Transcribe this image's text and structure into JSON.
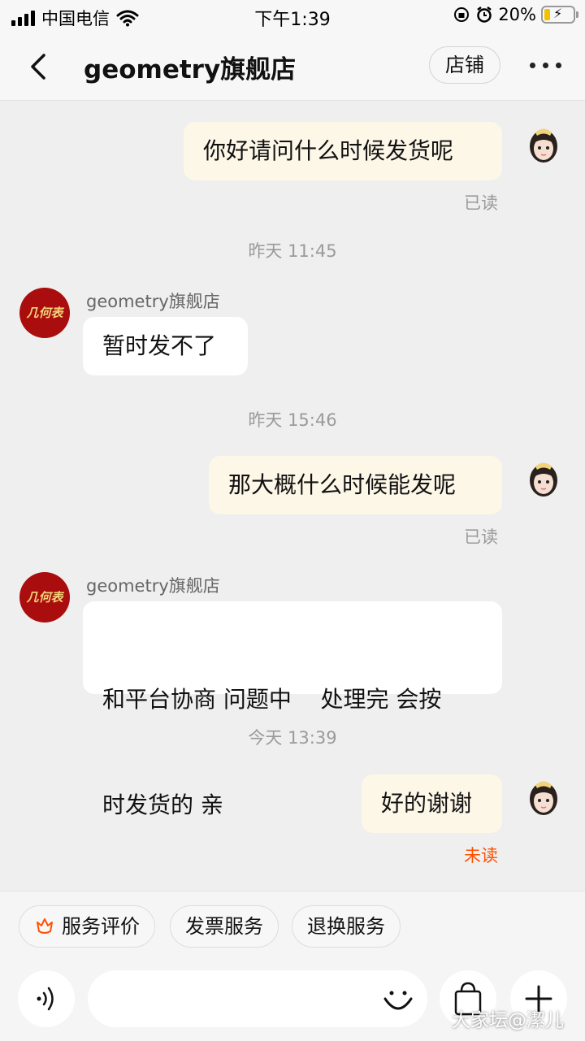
{
  "status_bar": {
    "carrier": "中国电信",
    "time": "下午1:39",
    "battery": "20%",
    "battery_level": 0.2
  },
  "header": {
    "title": "geometry旗舰店",
    "shop_button": "店铺"
  },
  "messages": [
    {
      "sender": "me",
      "text": "你好请问什么时候发货呢",
      "status": "已读"
    },
    {
      "timestamp": "昨天 11:45"
    },
    {
      "sender": "shop",
      "name": "geometry旗舰店",
      "text": "暂时发不了"
    },
    {
      "timestamp": "昨天 15:46"
    },
    {
      "sender": "me",
      "text": "那大概什么时候能发呢",
      "status": "已读"
    },
    {
      "sender": "shop",
      "name": "geometry旗舰店",
      "text_line1": "和平台协商 问题中    处理完 会按",
      "text_line2": "时发货的 亲"
    },
    {
      "timestamp": "今天 13:39"
    },
    {
      "sender": "me",
      "text": "好的谢谢",
      "status": "未读"
    }
  ],
  "shop_avatar_text": "几何表",
  "services": [
    "服务评价",
    "发票服务",
    "退换服务"
  ],
  "watermark": "大家坛@潔儿",
  "colors": {
    "outgoing_bubble": "#fdf7e8",
    "incoming_bubble": "#ffffff",
    "unread": "#ff5000",
    "accent": "#ff5000"
  }
}
